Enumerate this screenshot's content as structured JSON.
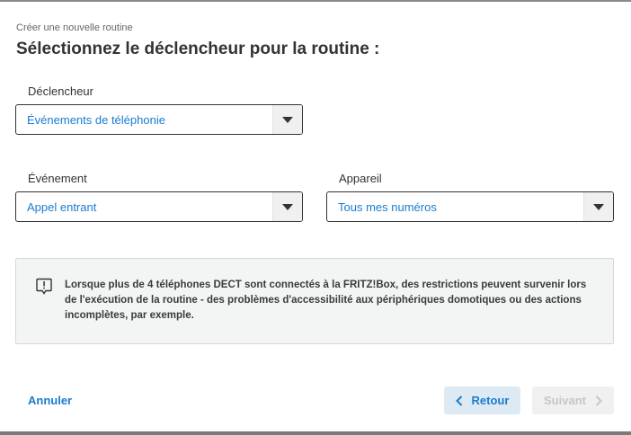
{
  "header": {
    "subtitle": "Créer une nouvelle routine",
    "title": "Sélectionnez le déclencheur pour la routine :"
  },
  "trigger": {
    "label": "Déclencheur",
    "selected": "Événements de téléphonie"
  },
  "event": {
    "label": "Événement",
    "selected": "Appel entrant"
  },
  "device": {
    "label": "Appareil",
    "selected": "Tous mes numéros"
  },
  "info": {
    "icon": "exclamation-speech-icon",
    "text": "Lorsque plus de 4 téléphones DECT sont connectés à la FRITZ!Box, des restrictions peuvent survenir lors de l'exécution de la routine - des problèmes d'accessibilité aux périphériques domotiques ou des actions incomplètes, par exemple."
  },
  "footer": {
    "cancel_label": "Annuler",
    "back_label": "Retour",
    "next_label": "Suivant"
  },
  "colors": {
    "accent": "#1a7ccf",
    "disabled": "#c6c6c6"
  }
}
